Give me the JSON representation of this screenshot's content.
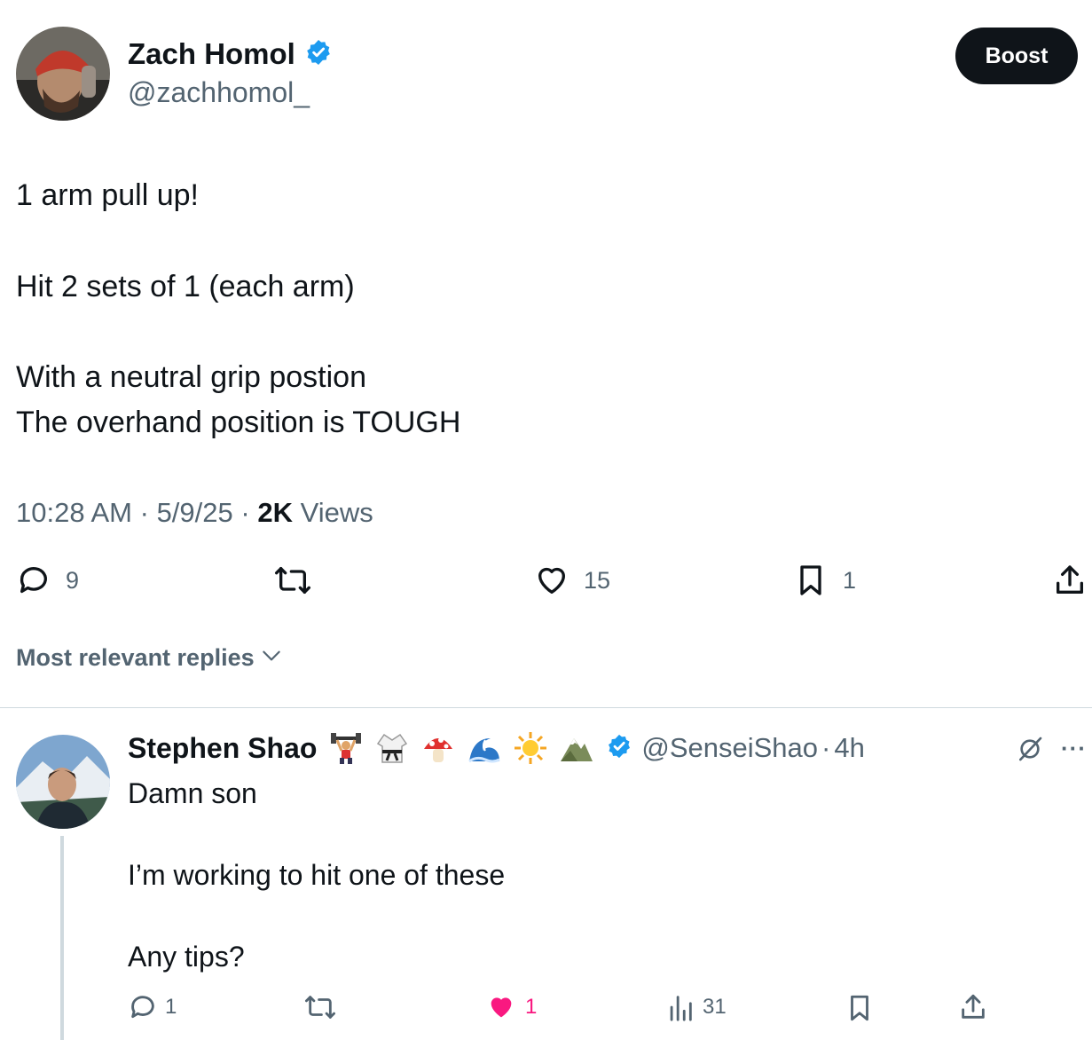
{
  "tweet": {
    "author": {
      "display_name": "Zach Homol",
      "handle": "@zachhomol_"
    },
    "boost_label": "Boost",
    "lines": [
      "1 arm pull up!",
      "Hit 2 sets of 1 (each arm)",
      "With a neutral grip postion",
      "The overhand position is TOUGH"
    ],
    "meta": {
      "time": "10:28 AM",
      "sep1": "·",
      "date": "5/9/25",
      "sep2": "·",
      "views_count": "2K",
      "views_label": "Views"
    },
    "actions": {
      "replies": "9",
      "likes": "15",
      "bookmarks": "1"
    }
  },
  "replies_header": "Most relevant replies",
  "reply": {
    "author": {
      "display_name": "Stephen Shao",
      "handle": "@SenseiShao",
      "sep": "·",
      "time": "4h"
    },
    "emojis": [
      "weightlifter-emoji",
      "martial-arts-uniform-emoji",
      "mushroom-emoji",
      "wave-emoji",
      "sun-emoji",
      "mountain-emoji"
    ],
    "lines": [
      "Damn son",
      "I’m working to hit one of these",
      "Any tips?"
    ],
    "actions": {
      "replies": "1",
      "likes": "1",
      "views": "31"
    },
    "more_label": "···"
  },
  "colors": {
    "verified": "#1d9bf0",
    "liked": "#f91880",
    "text": "#0f1419",
    "muted": "#536471"
  }
}
